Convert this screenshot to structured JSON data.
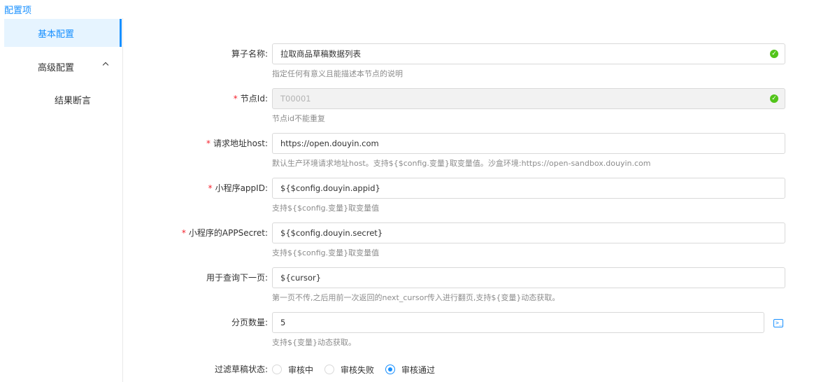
{
  "section_title": "配置项",
  "sidebar": {
    "items": [
      {
        "label": "基本配置"
      },
      {
        "label": "高级配置"
      },
      {
        "label": "结果断言"
      }
    ]
  },
  "form": {
    "operator_name": {
      "label": "算子名称:",
      "value": "拉取商品草稿数据列表",
      "help": "指定任何有意义且能描述本节点的说明"
    },
    "node_id": {
      "label": "节点Id:",
      "value": "T00001",
      "help": "节点id不能重复"
    },
    "host": {
      "label": "请求地址host:",
      "value": "https://open.douyin.com",
      "help": "默认生产环境请求地址host。支持${$config.变量}取变量值。沙盒环境:https://open-sandbox.douyin.com"
    },
    "appid": {
      "label": "小程序appID:",
      "value": "${$config.douyin.appid}",
      "help": "支持${$config.变量}取变量值"
    },
    "secret": {
      "label": "小程序的APPSecret:",
      "value": "${$config.douyin.secret}",
      "help": "支持${$config.变量}取变量值"
    },
    "next_page": {
      "label": "用于查询下一页:",
      "value": "${cursor}",
      "help": "第一页不传,之后用前一次返回的next_cursor传入进行翻页,支持${变量}动态获取。"
    },
    "page_size": {
      "label": "分页数量:",
      "value": "5",
      "help": "支持${变量}动态获取。"
    },
    "filter_status": {
      "label": "过滤草稿状态:",
      "options": [
        {
          "label": "审核中",
          "checked": false
        },
        {
          "label": "审核失败",
          "checked": false
        },
        {
          "label": "审核通过",
          "checked": true
        }
      ]
    }
  },
  "icons": {
    "valid": "check-circle-icon",
    "terminal": "terminal-icon",
    "expand": "chevron-up-icon"
  },
  "colors": {
    "accent": "#1890ff",
    "required": "#f5222d",
    "valid": "#52c41a"
  }
}
